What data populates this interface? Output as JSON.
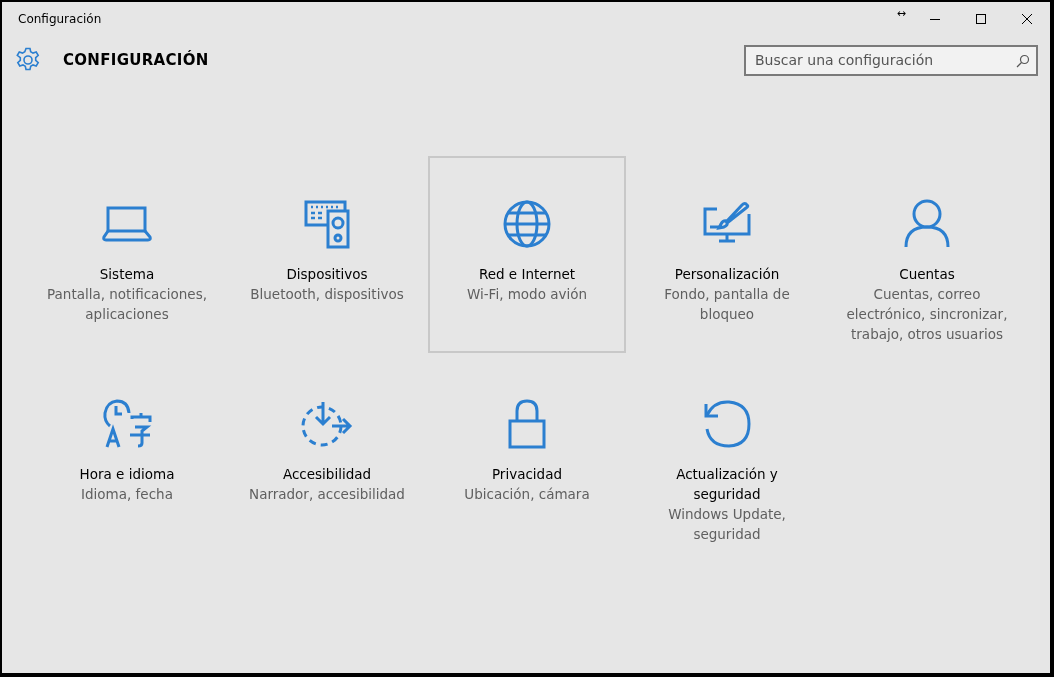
{
  "window": {
    "title": "Configuración",
    "controls": [
      "↔"
    ]
  },
  "header": {
    "title": "CONFIGURACIÓN"
  },
  "search": {
    "placeholder": "Buscar una configuración"
  },
  "tiles": [
    {
      "kind": "laptop",
      "title": "Sistema",
      "subtitle": "Pantalla, notificaciones, aplicaciones",
      "selected": false
    },
    {
      "kind": "devices",
      "title": "Dispositivos",
      "subtitle": "Bluetooth, dispositivos",
      "selected": false
    },
    {
      "kind": "globe",
      "title": "Red e Internet",
      "subtitle": "Wi-Fi, modo avión",
      "selected": true
    },
    {
      "kind": "paint",
      "title": "Personalización",
      "subtitle": "Fondo, pantalla de bloqueo",
      "selected": false
    },
    {
      "kind": "person",
      "title": "Cuentas",
      "subtitle": "Cuentas, correo electrónico, sincronizar, trabajo, otros usuarios",
      "selected": false
    },
    {
      "kind": "language",
      "title": "Hora e idioma",
      "subtitle": "Idioma, fecha",
      "selected": false
    },
    {
      "kind": "access",
      "title": "Accesibilidad",
      "subtitle": "Narrador, accesibilidad",
      "selected": false
    },
    {
      "kind": "lock",
      "title": "Privacidad",
      "subtitle": "Ubicación, cámara",
      "selected": false
    },
    {
      "kind": "update",
      "title": "Actualización y seguridad",
      "subtitle": "Windows Update, seguridad",
      "selected": false
    }
  ]
}
